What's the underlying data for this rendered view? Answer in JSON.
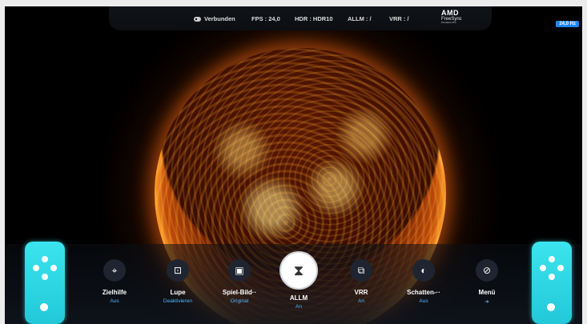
{
  "status_bar": {
    "connection": "Verbunden",
    "fps": "FPS : 24,0",
    "hdr": "HDR : HDR10",
    "allm": "ALLM : /",
    "vrr": "VRR : /",
    "brand": "AMD",
    "brand_sub": "FreeSync",
    "brand_tier": "Premium Pro"
  },
  "refresh_badge": "24,0 Hz",
  "menu": [
    {
      "label": "Zielhilfe",
      "sub": "Aus",
      "icon": "crosshair-icon",
      "glyph": "⌖"
    },
    {
      "label": "Lupe",
      "sub": "Deaktivieren",
      "icon": "magnifier-icon",
      "glyph": "⊡"
    },
    {
      "label": "Spiel-Bild··",
      "sub": "Original",
      "icon": "picture-icon",
      "glyph": "▣"
    },
    {
      "label": "ALLM",
      "sub": "An",
      "icon": "hourglass-icon",
      "glyph": "⧗"
    },
    {
      "label": "VRR",
      "sub": "An",
      "icon": "vrr-icon",
      "glyph": "⧉"
    },
    {
      "label": "Schatten-··",
      "sub": "Aus",
      "icon": "contrast-icon",
      "glyph": "◐"
    },
    {
      "label": "Menü",
      "sub": "➜",
      "icon": "menu-compass-icon",
      "glyph": "⊘"
    }
  ],
  "colors": {
    "accent": "#1d84ff",
    "joycon": "#2ed8e4",
    "sub_text": "#4eb6ff"
  }
}
